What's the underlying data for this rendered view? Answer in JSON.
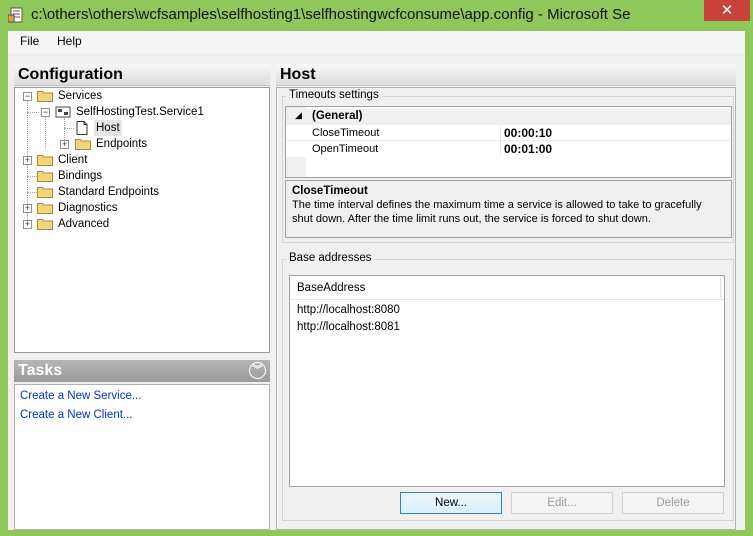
{
  "window": {
    "title": "c:\\others\\others\\wcfsamples\\selfhosting1\\selfhostingwcfconsume\\app.config - Microsoft Se",
    "close_glyph": "✕"
  },
  "menu": [
    {
      "label": "File"
    },
    {
      "label": "Help"
    }
  ],
  "configuration": {
    "header": "Configuration",
    "tree": {
      "services": "Services",
      "service1": "SelfHostingTest.Service1",
      "host": "Host",
      "endpoints": "Endpoints",
      "client": "Client",
      "bindings": "Bindings",
      "standard_endpoints": "Standard Endpoints",
      "diagnostics": "Diagnostics",
      "advanced": "Advanced"
    }
  },
  "tasks": {
    "header": "Tasks",
    "links": [
      "Create a New Service...",
      "Create a New Client..."
    ]
  },
  "host": {
    "header": "Host",
    "timeouts_group": "Timeouts settings",
    "category": "(General)",
    "properties": [
      {
        "name": "CloseTimeout",
        "value": "00:00:10"
      },
      {
        "name": "OpenTimeout",
        "value": "00:01:00"
      }
    ],
    "description_title": "CloseTimeout",
    "description_text": "The time interval defines the maximum time a service is allowed to take to gracefully shut down. After the time limit runs out, the service is forced to shut down.",
    "base_addresses_group": "Base addresses",
    "list_header": "BaseAddress",
    "addresses": [
      "http://localhost:8080",
      "http://localhost:8081"
    ],
    "buttons": {
      "new": "New...",
      "edit": "Edit...",
      "delete": "Delete"
    }
  },
  "colors": {
    "titlebar": "#8fc85a",
    "close": "#c7433a",
    "link": "#0033cc",
    "folder": "#f3d57b"
  }
}
